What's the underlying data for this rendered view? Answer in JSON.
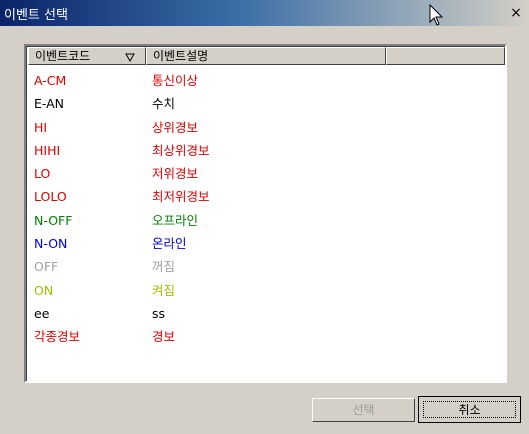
{
  "window": {
    "title": "이벤트 선택",
    "close": "×"
  },
  "table": {
    "columns": [
      "이벤트코드",
      "이벤트설명"
    ],
    "rows": [
      {
        "code": "A-CM",
        "desc": "통신이상",
        "color": "#e00000"
      },
      {
        "code": "E-AN",
        "desc": "수치",
        "color": "#000000"
      },
      {
        "code": "HI",
        "desc": "상위경보",
        "color": "#e00000"
      },
      {
        "code": "HIHI",
        "desc": "최상위경보",
        "color": "#e00000"
      },
      {
        "code": "LO",
        "desc": "저위경보",
        "color": "#e00000"
      },
      {
        "code": "LOLO",
        "desc": "최저위경보",
        "color": "#e00000"
      },
      {
        "code": "N-OFF",
        "desc": "오프라인",
        "color": "#008000"
      },
      {
        "code": "N-ON",
        "desc": "온라인",
        "color": "#0000e0"
      },
      {
        "code": "OFF",
        "desc": "꺼짐",
        "color": "#a0a0a0"
      },
      {
        "code": "ON",
        "desc": "켜짐",
        "color": "#a0c000"
      },
      {
        "code": "ee",
        "desc": "ss",
        "color": "#000000"
      },
      {
        "code": "각종경보",
        "desc": "경보",
        "color": "#e00000"
      }
    ]
  },
  "buttons": {
    "select": "선택",
    "cancel": "취소"
  }
}
